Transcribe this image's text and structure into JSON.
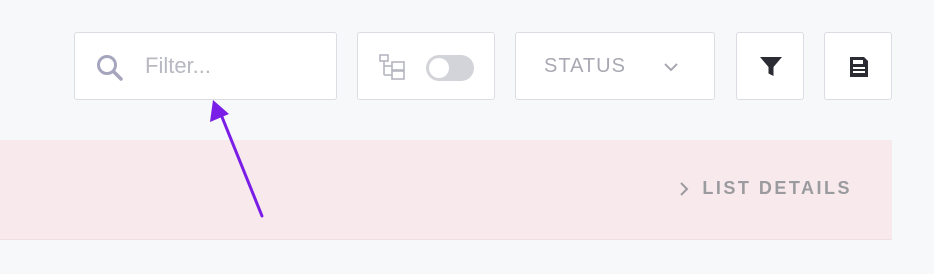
{
  "search": {
    "placeholder": "Filter...",
    "icon": "search-icon"
  },
  "tree_toggle": {
    "icon": "tree-icon",
    "state": "off"
  },
  "status_dropdown": {
    "label": "STATUS",
    "icon": "chevron-down-icon"
  },
  "toolbar": {
    "filter_icon": "filter-icon",
    "save_icon": "save-icon"
  },
  "banner": {
    "details_label": "LIST DETAILS",
    "details_icon": "chevron-right-icon",
    "background": "#f8e9ec"
  },
  "annotation": {
    "arrow_color": "#7a1de6"
  }
}
